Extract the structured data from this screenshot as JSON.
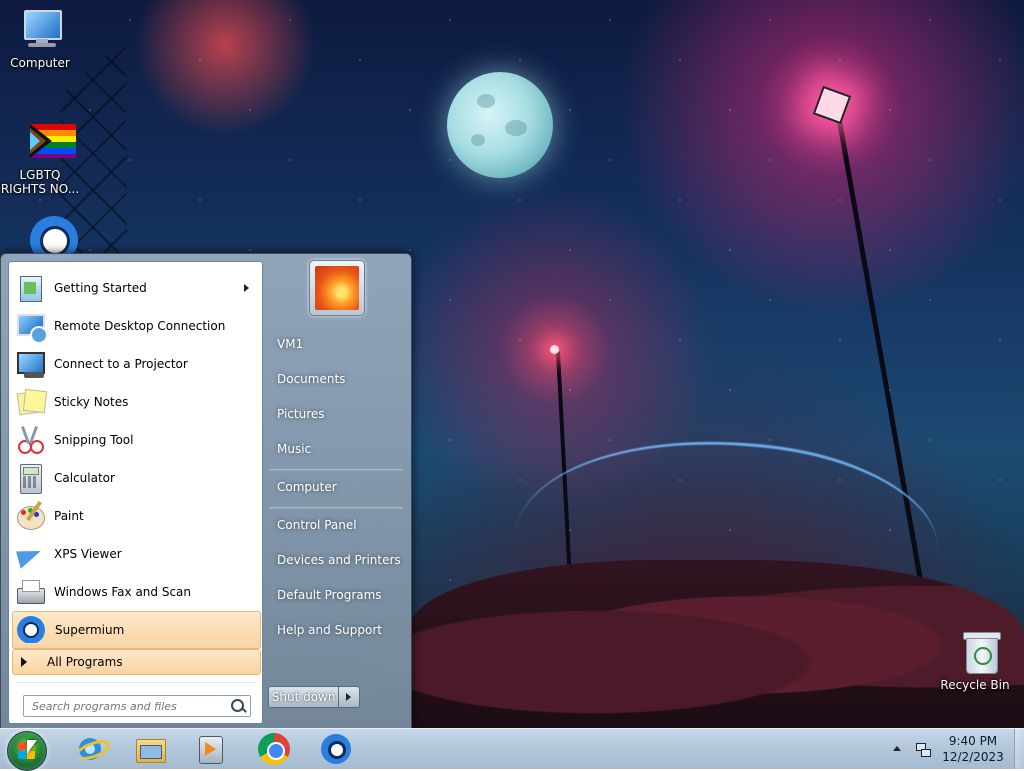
{
  "desktop": {
    "icons": [
      {
        "label": "Computer"
      },
      {
        "label": "LGBTQ RIGHTS NO..."
      },
      {
        "label": "Recycle Bin"
      }
    ]
  },
  "start_menu": {
    "programs": [
      {
        "label": "Getting Started",
        "has_submenu": true
      },
      {
        "label": "Remote Desktop Connection"
      },
      {
        "label": "Connect to a Projector"
      },
      {
        "label": "Sticky Notes"
      },
      {
        "label": "Snipping Tool"
      },
      {
        "label": "Calculator"
      },
      {
        "label": "Paint"
      },
      {
        "label": "XPS Viewer"
      },
      {
        "label": "Windows Fax and Scan"
      },
      {
        "label": "Supermium"
      }
    ],
    "all_programs_label": "All Programs",
    "search_placeholder": "Search programs and files",
    "right_links": [
      {
        "label": "VM1"
      },
      {
        "label": "Documents"
      },
      {
        "label": "Pictures"
      },
      {
        "label": "Music"
      },
      {
        "label": "Computer"
      },
      {
        "label": "Control Panel"
      },
      {
        "label": "Devices and Printers"
      },
      {
        "label": "Default Programs"
      },
      {
        "label": "Help and Support"
      }
    ],
    "shutdown_label": "Shut down"
  },
  "taskbar": {
    "pinned": [
      {
        "icon": "internet-explorer-icon"
      },
      {
        "icon": "file-explorer-icon"
      },
      {
        "icon": "media-player-icon"
      },
      {
        "icon": "chrome-icon"
      },
      {
        "icon": "supermium-icon"
      }
    ],
    "clock": {
      "time": "9:40 PM",
      "date": "12/2/2023"
    }
  },
  "colors": {
    "highlight": "#fbd3a0",
    "taskbar": "#b2c6da",
    "start_panel": "#8fa4b8"
  }
}
